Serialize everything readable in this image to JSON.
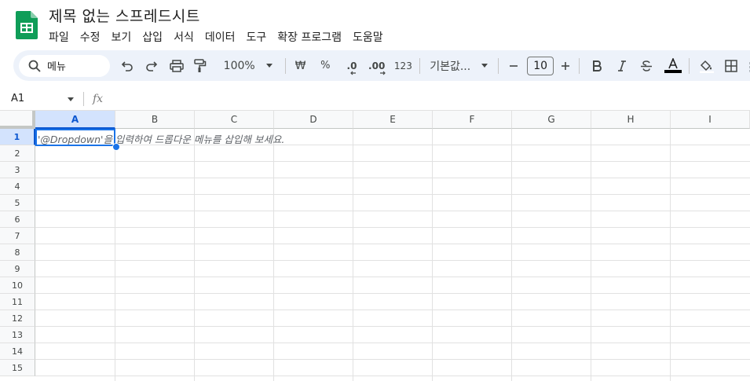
{
  "app": {
    "title": "제목 없는 스프레드시트",
    "logo_icon": "google-sheets-logo",
    "brand_color": "#0f9d58"
  },
  "menu": {
    "items": [
      "파일",
      "수정",
      "보기",
      "삽입",
      "서식",
      "데이터",
      "도구",
      "확장 프로그램",
      "도움말"
    ]
  },
  "toolbar": {
    "search_label": "메뉴",
    "zoom": "100%",
    "currency_label": "₩",
    "percent_label": "%",
    "decrease_decimal_label": ".0",
    "increase_decimal_label": ".00",
    "number_format_label": "123",
    "font_name": "기본값...",
    "font_size": "10",
    "text_color": "#000000"
  },
  "formula_bar": {
    "name_box": "A1",
    "fx_label": "fx",
    "value": ""
  },
  "sheet": {
    "columns": [
      "A",
      "B",
      "C",
      "D",
      "E",
      "F",
      "G",
      "H",
      "I"
    ],
    "rows": [
      "1",
      "2",
      "3",
      "4",
      "5",
      "6",
      "7",
      "8",
      "9",
      "10",
      "11",
      "12",
      "13",
      "14",
      "15"
    ],
    "selected_cell": "A1",
    "selection_color": "#1a73e8",
    "cell_hint": "'@Dropdown'을 입력하여 드롭다운 메뉴를 삽입해 보세요."
  }
}
